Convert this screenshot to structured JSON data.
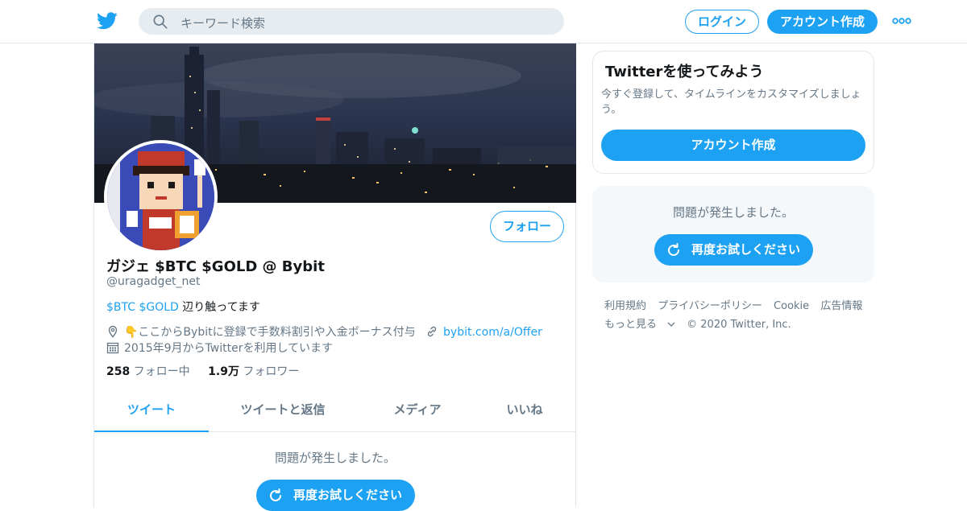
{
  "header": {
    "search_placeholder": "キーワード検索",
    "login_label": "ログイン",
    "signup_label": "アカウント作成"
  },
  "profile": {
    "display_name": "ガジェ $BTC $GOLD @ Bybit",
    "handle": "@uragadget_net",
    "bio_links": "$BTC $GOLD",
    "bio_text": " 辺り触ってます",
    "location": "👇ここからBybitに登録で手数料割引や入金ボーナス付与",
    "website": "bybit.com/a/Offer",
    "joined": "2015年9月からTwitterを利用しています",
    "following_count": "258",
    "following_label": " フォロー中",
    "followers_count": "1.9万",
    "followers_label": " フォロワー",
    "follow_label": "フォロー"
  },
  "tabs": [
    {
      "label": "ツイート",
      "active": true
    },
    {
      "label": "ツイートと返信",
      "active": false
    },
    {
      "label": "メディア",
      "active": false
    },
    {
      "label": "いいね",
      "active": false
    }
  ],
  "main_error": {
    "message": "問題が発生しました。",
    "retry_label": "再度お試しください"
  },
  "sidebar": {
    "promo_title": "Twitterを使ってみよう",
    "promo_text": "今すぐ登録して、タイムラインをカスタマイズしましょう。",
    "promo_button": "アカウント作成",
    "error_message": "問題が発生しました。",
    "retry_label": "再度お試しください"
  },
  "footer": {
    "links": [
      "利用規約",
      "プライバシーポリシー",
      "Cookie",
      "広告情報"
    ],
    "more_label": "もっと見る",
    "copyright": "© 2020 Twitter, Inc."
  },
  "colors": {
    "accent": "#1da1f2",
    "muted": "#657786",
    "text": "#14171a",
    "panel": "#f5f8fa"
  },
  "icons": [
    "twitter-logo-icon",
    "search-icon",
    "more-icon",
    "location-icon",
    "link-icon",
    "calendar-icon",
    "refresh-icon",
    "chevron-down-icon"
  ]
}
